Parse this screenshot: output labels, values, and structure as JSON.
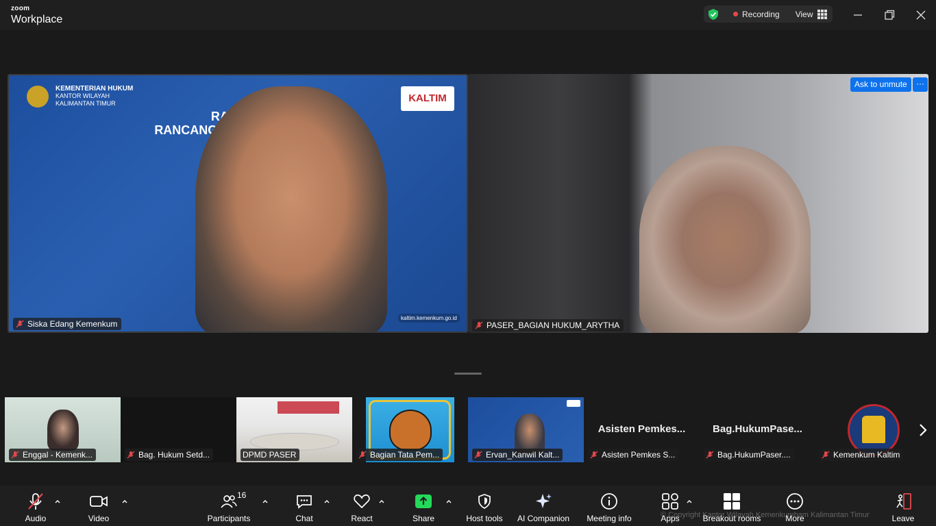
{
  "app": {
    "brand_small": "zoom",
    "brand_big": "Workplace",
    "recording_label": "Recording",
    "view_label": "View"
  },
  "main_tiles": [
    {
      "name": "Siska Edang Kemenkum",
      "slide_ministry_line1": "KEMENTERIAN HUKUM",
      "slide_ministry_line2": "KANTOR WILAYAH",
      "slide_ministry_line3": "KALIMANTAN TIMUR",
      "slide_title_line1": "RAPAT HA",
      "slide_title_line2": "RANCANGAN PERA              R",
      "slide_logo_text": "KALTIM",
      "slide_url": "kaltim.kemenkum.go.id"
    },
    {
      "name": "PASER_BAGIAN HUKUM_ARYTHA",
      "ask_unmute": "Ask to unmute",
      "more": "···"
    }
  ],
  "filmstrip": [
    {
      "name": "Enggal - Kemenk...",
      "muted": true
    },
    {
      "name": "Bag. Hukum Setd...",
      "muted": true
    },
    {
      "name": "DPMD PASER",
      "muted": false
    },
    {
      "name": "Bagian Tata Pem...",
      "muted": true
    },
    {
      "name": "Ervan_Kanwil Kalt...",
      "muted": true
    },
    {
      "name": "Asisten Pemkes S...",
      "muted": true,
      "big_name": "Asisten Pemkes..."
    },
    {
      "name": "Bag.HukumPaser....",
      "muted": true,
      "big_name": "Bag.HukumPase..."
    },
    {
      "name": "Kemenkum Kaltim",
      "muted": true
    }
  ],
  "toolbar": {
    "audio": "Audio",
    "video": "Video",
    "participants": "Participants",
    "participants_count": "16",
    "chat": "Chat",
    "react": "React",
    "share": "Share",
    "host_tools": "Host tools",
    "ai_companion": "AI Companion",
    "meeting_info": "Meeting info",
    "apps": "Apps",
    "breakout_rooms": "Breakout rooms",
    "more": "More",
    "leave": "Leave",
    "watermark": "© Copyright Kantor Wilayah Kemenkumham Kalimantan Timur"
  },
  "colors": {
    "accent_blue": "#0e72ed",
    "share_green": "#23d959",
    "leave_red": "#e5484d",
    "shield_green": "#23c55e"
  }
}
